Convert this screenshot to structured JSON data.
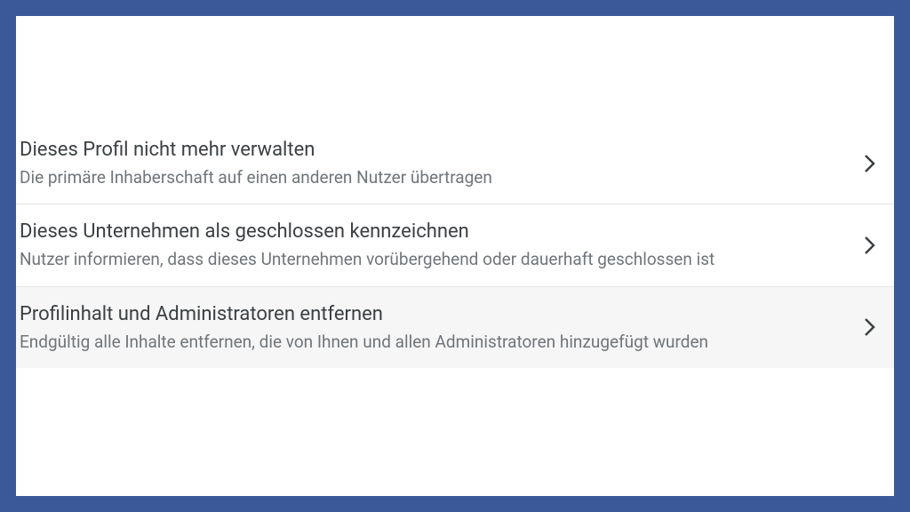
{
  "options": [
    {
      "title": "Dieses Profil nicht mehr verwalten",
      "description": "Die primäre Inhaberschaft auf einen anderen Nutzer übertragen",
      "highlighted": false
    },
    {
      "title": "Dieses Unternehmen als geschlossen kennzeichnen",
      "description": "Nutzer informieren, dass dieses Unternehmen vorübergehend oder dauerhaft geschlossen ist",
      "highlighted": false
    },
    {
      "title": "Profilinhalt und Administratoren entfernen",
      "description": "Endgültig alle Inhalte entfernen, die von Ihnen und allen Administratoren hinzugefügt wurden",
      "highlighted": true
    }
  ]
}
